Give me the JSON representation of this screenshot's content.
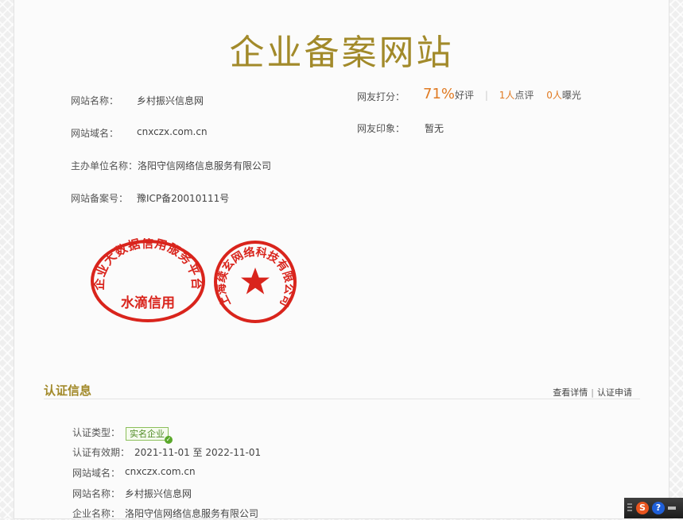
{
  "page": {
    "title": "企业备案网站"
  },
  "info": {
    "site_name_label": "网站名称：",
    "site_name": "乡村振兴信息网",
    "domain_label": "网站域名：",
    "domain": "cnxczx.com.cn",
    "org_label": "主办单位名称：",
    "org": "洛阳守信网络信息服务有限公司",
    "icp_label": "网站备案号：",
    "icp": "豫ICP备20010111号"
  },
  "rating": {
    "label": "网友打分：",
    "percent": "71%",
    "percent_suffix": "好评",
    "divider": "|",
    "reviews_count": "1人",
    "reviews_suffix": "点评",
    "exposure_count": "0人",
    "exposure_suffix": "曝光",
    "impression_label": "网友印象：",
    "impression": "暂无"
  },
  "stamps": {
    "left_ring": "企业大数据信用服务平台",
    "left_center": "水滴信用",
    "right_ring": "上海续玄网络科技有限公司",
    "stamp_color": "#d9241c"
  },
  "certification": {
    "title": "认证信息",
    "link_details": "查看详情",
    "link_separator": "|",
    "link_apply": "认证申请",
    "type_label": "认证类型：",
    "type_badge": "实名企业",
    "validity_label": "认证有效期：",
    "validity": "2021-11-01 至 2022-11-01",
    "domain_label": "网站域名：",
    "domain": "cnxczx.com.cn",
    "site_name_label": "网站名称：",
    "site_name": "乡村振兴信息网",
    "company_label": "企业名称：",
    "company": "洛阳守信网络信息服务有限公司"
  },
  "tray": {
    "ime_icon": "sogou-ime-icon",
    "help_icon": "help-icon"
  },
  "colors": {
    "accent_gold": "#a28a2a",
    "accent_orange": "#e07a22",
    "badge_green": "#4d8a22"
  }
}
